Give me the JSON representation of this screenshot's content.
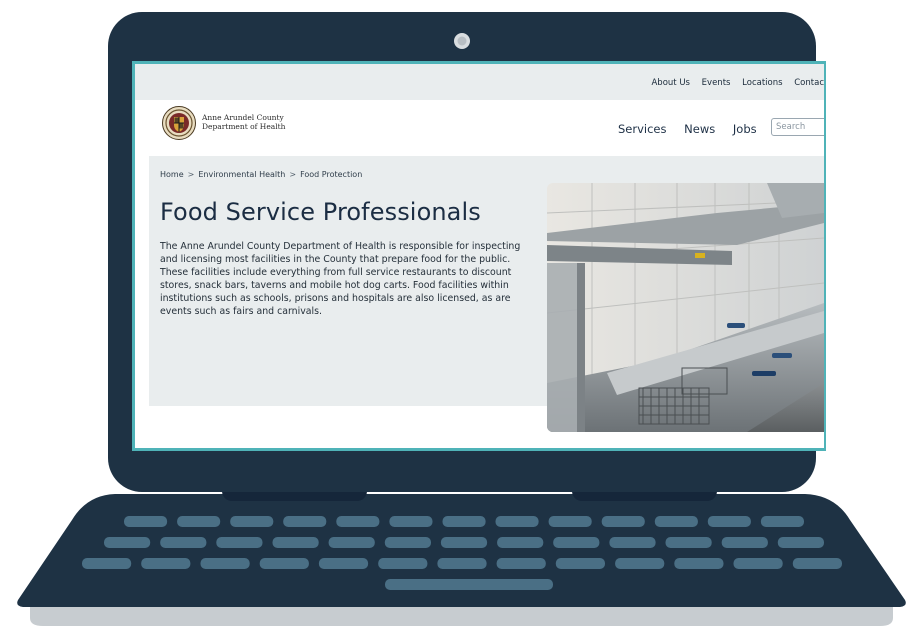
{
  "utility_nav": {
    "about": "About Us",
    "events": "Events",
    "locations": "Locations",
    "contact": "Contac"
  },
  "header": {
    "logo_line1": "Anne Arundel County",
    "logo_line2": "Department of Health"
  },
  "main_nav": {
    "services": "Services",
    "news": "News",
    "jobs": "Jobs"
  },
  "search": {
    "placeholder": "Search"
  },
  "breadcrumb": [
    "Home",
    "Environmental Health",
    "Food Protection"
  ],
  "breadcrumb_sep": ">",
  "page": {
    "title": "Food Service Professionals",
    "intro": "The Anne Arundel County Department of Health is responsible for inspecting and licensing most facilities in the County that prepare food for the public. These facilities include everything from full service restaurants to discount stores, snack bars, taverns and mobile hot dog carts. Food facilities within institutions such as schools, prisons and hospitals are also licensed, as are events such as fairs and carnivals."
  },
  "colors": {
    "laptop_body": "#1e3244",
    "screen_bezel_accent": "#4fb3b8",
    "keyboard_keys": "#4a6f85",
    "page_band": "#e9edee",
    "title_text": "#1b2d43"
  }
}
